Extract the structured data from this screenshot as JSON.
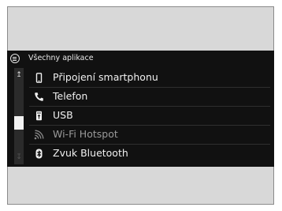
{
  "header": {
    "title": "Všechny aplikace",
    "menu_icon": "menu-icon"
  },
  "scrollbar": {
    "up_icon": "↥",
    "down_icon": "↧",
    "position": 0.62,
    "visible_fraction": 0.2
  },
  "items": [
    {
      "label": "Připojení smartphonu",
      "icon": "smartphone-icon",
      "enabled": true
    },
    {
      "label": "Telefon",
      "icon": "phone-icon",
      "enabled": true
    },
    {
      "label": "USB",
      "icon": "usb-icon",
      "enabled": true
    },
    {
      "label": "Wi-Fi Hotspot",
      "icon": "wifi-icon",
      "enabled": false
    },
    {
      "label": "Zvuk Bluetooth",
      "icon": "bluetooth-icon",
      "enabled": true
    }
  ],
  "colors": {
    "screen_bg": "#111111",
    "text": "#f0f0f0",
    "disabled_text": "#9a9a9a",
    "frame_bg": "#d8d8d8"
  }
}
